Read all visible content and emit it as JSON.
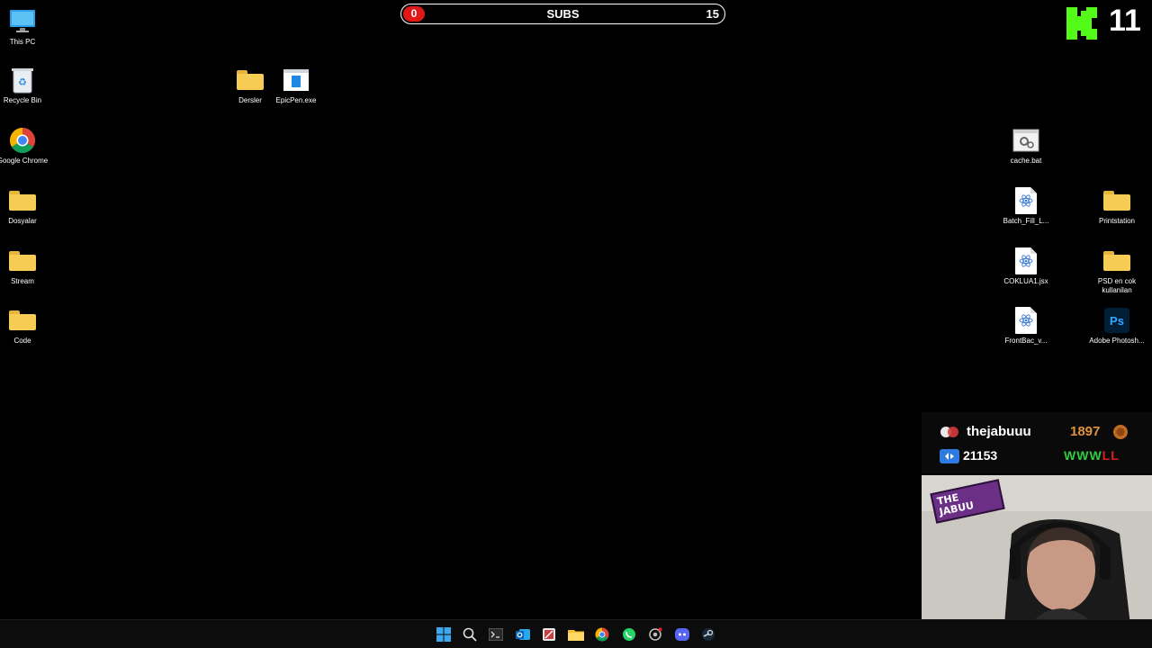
{
  "subs_bar": {
    "start": "0",
    "title": "SUBS",
    "goal": "15",
    "progress": 0
  },
  "kick_count": "11",
  "desktop_left": [
    {
      "label": "This PC",
      "icon": "monitor-icon"
    },
    {
      "label": "Recycle Bin",
      "icon": "recycle-bin-icon"
    },
    {
      "label": "Google Chrome",
      "icon": "chrome-icon"
    },
    {
      "label": "Dosyalar",
      "icon": "folder-icon"
    },
    {
      "label": "Stream",
      "icon": "folder-icon"
    },
    {
      "label": "Code",
      "icon": "folder-icon"
    }
  ],
  "desktop_middle": [
    {
      "label": "Dersler",
      "icon": "folder-icon"
    },
    {
      "label": "EpicPen.exe",
      "icon": "epicpen-icon"
    }
  ],
  "desktop_right": [
    {
      "label": "cache.bat",
      "icon": "batch-file-icon"
    },
    {
      "label": "Batch_Fill_L...",
      "icon": "script-file-icon"
    },
    {
      "label": "Printstation",
      "icon": "folder-icon"
    },
    {
      "label": "COKLUA1.jsx",
      "icon": "script-file-icon"
    },
    {
      "label": "PSD en cok kullanilan",
      "icon": "folder-icon"
    },
    {
      "label": "FrontBac_v...",
      "icon": "script-file-icon"
    },
    {
      "label": "Adobe Photosh...",
      "icon": "photoshop-icon"
    }
  ],
  "stream": {
    "username": "thejabuuu",
    "points": "1897",
    "views": "21153",
    "record": "WWWLL",
    "colors": {
      "win": "#2ecc40",
      "loss": "#e02020",
      "points": "#e0933a"
    }
  },
  "webcam_sticker": "THE JABUU",
  "taskbar": [
    "windows-start-icon",
    "search-icon",
    "terminal-icon",
    "outlook-icon",
    "snipping-tool-icon",
    "file-explorer-icon",
    "chrome-icon",
    "whatsapp-icon",
    "settings-icon",
    "discord-icon",
    "steam-icon"
  ]
}
